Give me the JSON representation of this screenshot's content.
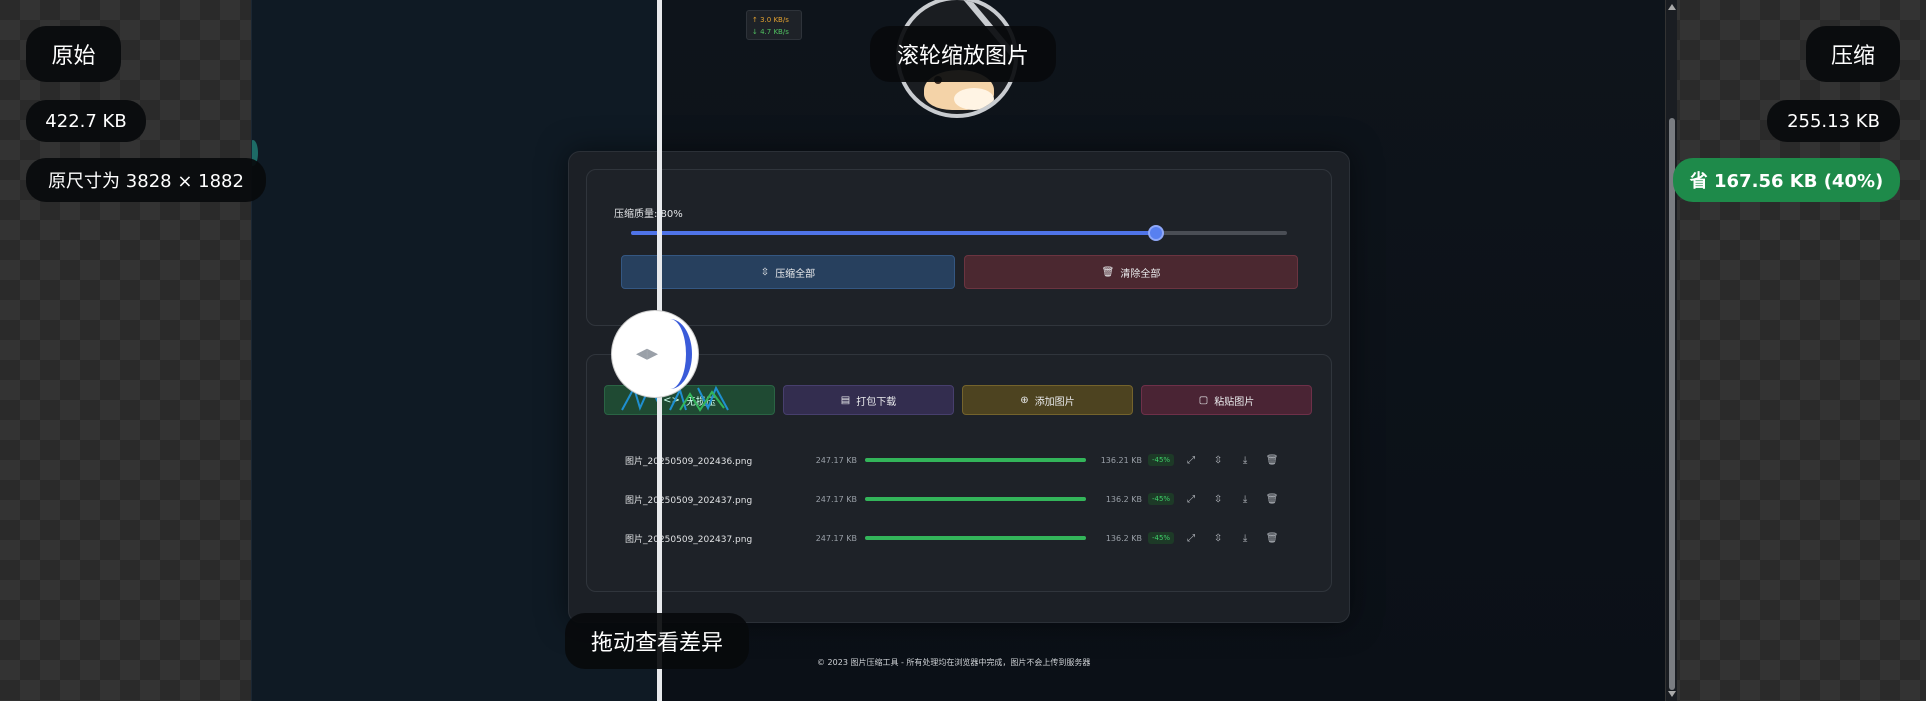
{
  "labels": {
    "original": "原始",
    "original_size": "422.7 KB",
    "original_dimensions": "原尺寸为 3828 × 1882",
    "zoom_hint": "滚轮缩放图片",
    "compressed": "压缩",
    "compressed_size": "255.13 KB",
    "saved": "省 167.56 KB (40%)",
    "drag_hint": "拖动查看差异"
  },
  "netspeed": {
    "up": "↑ 3.0 KB/s",
    "down": "↓ 4.7 KB/s"
  },
  "settings": {
    "quality_label": "压缩质量: 80%",
    "quality_value": 0.8,
    "compress_all": "压缩全部",
    "clear_all": "清除全部"
  },
  "actions": {
    "uncompressed": "无损压",
    "zip_download": "打包下载",
    "add_images": "添加图片",
    "paste_images": "粘贴图片"
  },
  "files": [
    {
      "name": "图片_20250509_202436.png",
      "original": "247.17 KB",
      "compressed": "136.21 KB",
      "percent": "-45%",
      "progress": 1.0
    },
    {
      "name": "图片_20250509_202437.png",
      "original": "247.17 KB",
      "compressed": "136.2 KB",
      "percent": "-45%",
      "progress": 1.0
    },
    {
      "name": "图片_20250509_202437.png",
      "original": "247.17 KB",
      "compressed": "136.2 KB",
      "percent": "-45%",
      "progress": 1.0
    }
  ],
  "footer": "© 2023 图片压缩工具 - 所有处理均在浏览器中完成，图片不会上传到服务器",
  "colors": {
    "accent_blue": "#4f74e8",
    "success_green": "#33b55a",
    "saved_badge": "#1e8a4a"
  }
}
